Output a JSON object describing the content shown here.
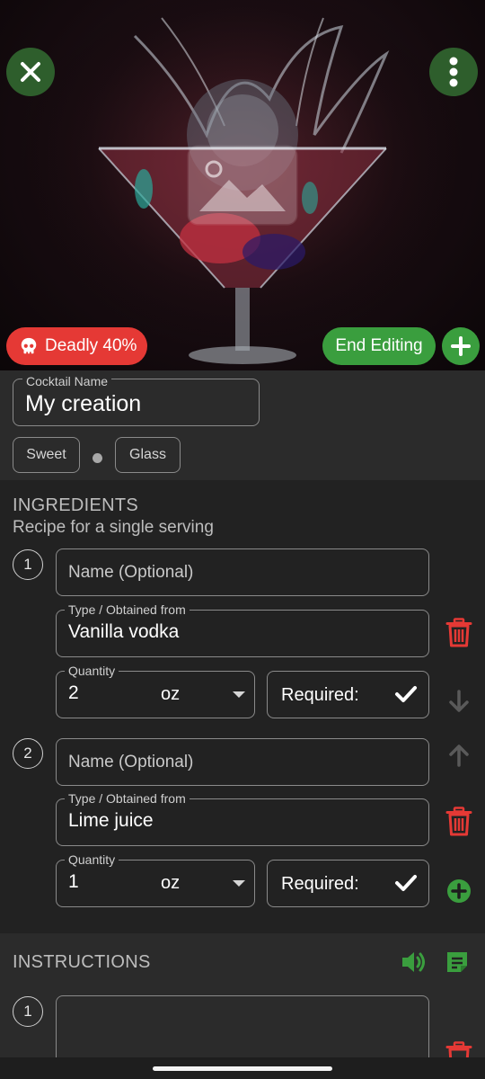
{
  "hero": {
    "deadly_label": "Deadly 40%",
    "end_editing_label": "End Editing"
  },
  "cocktail": {
    "name_label": "Cocktail Name",
    "name_value": "My creation",
    "tags": [
      "Sweet",
      "Glass"
    ]
  },
  "ingredients": {
    "title": "INGREDIENTS",
    "subtitle": "Recipe for a single serving",
    "items": [
      {
        "number": "1",
        "name_placeholder": "Name (Optional)",
        "type_label": "Type / Obtained from",
        "type_value": "Vanilla vodka",
        "quantity_label": "Quantity",
        "quantity_value": "2",
        "unit": "oz",
        "required_label": "Required:",
        "required": true
      },
      {
        "number": "2",
        "name_placeholder": "Name (Optional)",
        "type_label": "Type / Obtained from",
        "type_value": "Lime juice",
        "quantity_label": "Quantity",
        "quantity_value": "1",
        "unit": "oz",
        "required_label": "Required:",
        "required": true
      }
    ]
  },
  "instructions": {
    "title": "INSTRUCTIONS",
    "steps": [
      {
        "number": "1",
        "text": ""
      }
    ]
  },
  "colors": {
    "accent_green": "#3a9e3e",
    "danger_red": "#e53935",
    "background": "#222222"
  }
}
